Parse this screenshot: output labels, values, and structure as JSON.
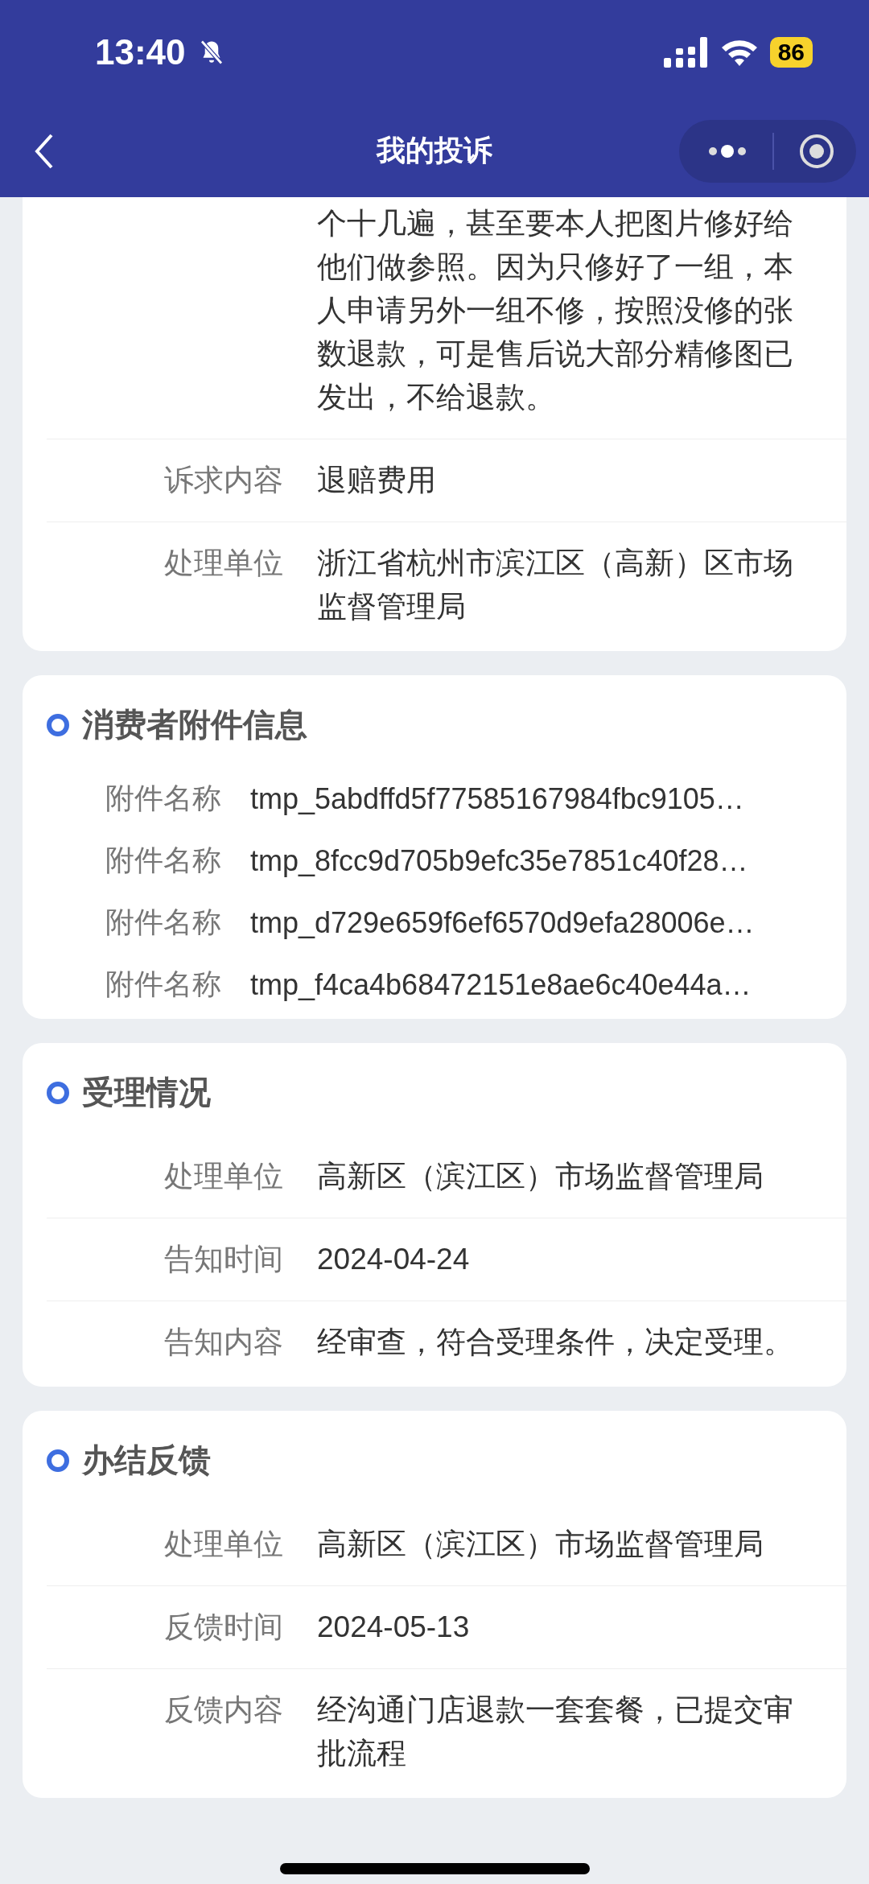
{
  "status_bar": {
    "time": "13:40",
    "battery": "86"
  },
  "nav": {
    "title": "我的投诉"
  },
  "complaint_card": {
    "rows": [
      {
        "label": "",
        "value": "个十几遍，甚至要本人把图片修好给他们做参照。因为只修好了一组，本人申请另外一组不修，按照没修的张数退款，可是售后说大部分精修图已发出，不给退款。"
      },
      {
        "label": "诉求内容",
        "value": "退赔费用"
      },
      {
        "label": "处理单位",
        "value": "浙江省杭州市滨江区（高新）区市场监督管理局"
      }
    ]
  },
  "sections": [
    {
      "title": "消费者附件信息",
      "kind": "attachments",
      "rows": [
        {
          "label": "附件名称",
          "value": "tmp_5abdffd5f77585167984fbc9105…"
        },
        {
          "label": "附件名称",
          "value": "tmp_8fcc9d705b9efc35e7851c40f28…"
        },
        {
          "label": "附件名称",
          "value": "tmp_d729e659f6ef6570d9efa28006e…"
        },
        {
          "label": "附件名称",
          "value": "tmp_f4ca4b68472151e8ae6c40e44a…"
        }
      ]
    },
    {
      "title": "受理情况",
      "kind": "details",
      "rows": [
        {
          "label": "处理单位",
          "value": "高新区（滨江区）市场监督管理局"
        },
        {
          "label": "告知时间",
          "value": "2024-04-24"
        },
        {
          "label": "告知内容",
          "value": "经审查，符合受理条件，决定受理。"
        }
      ]
    },
    {
      "title": "办结反馈",
      "kind": "details",
      "rows": [
        {
          "label": "处理单位",
          "value": "高新区（滨江区）市场监督管理局"
        },
        {
          "label": "反馈时间",
          "value": "2024-05-13"
        },
        {
          "label": "反馈内容",
          "value": "经沟通门店退款一套套餐，已提交审批流程"
        }
      ]
    }
  ]
}
